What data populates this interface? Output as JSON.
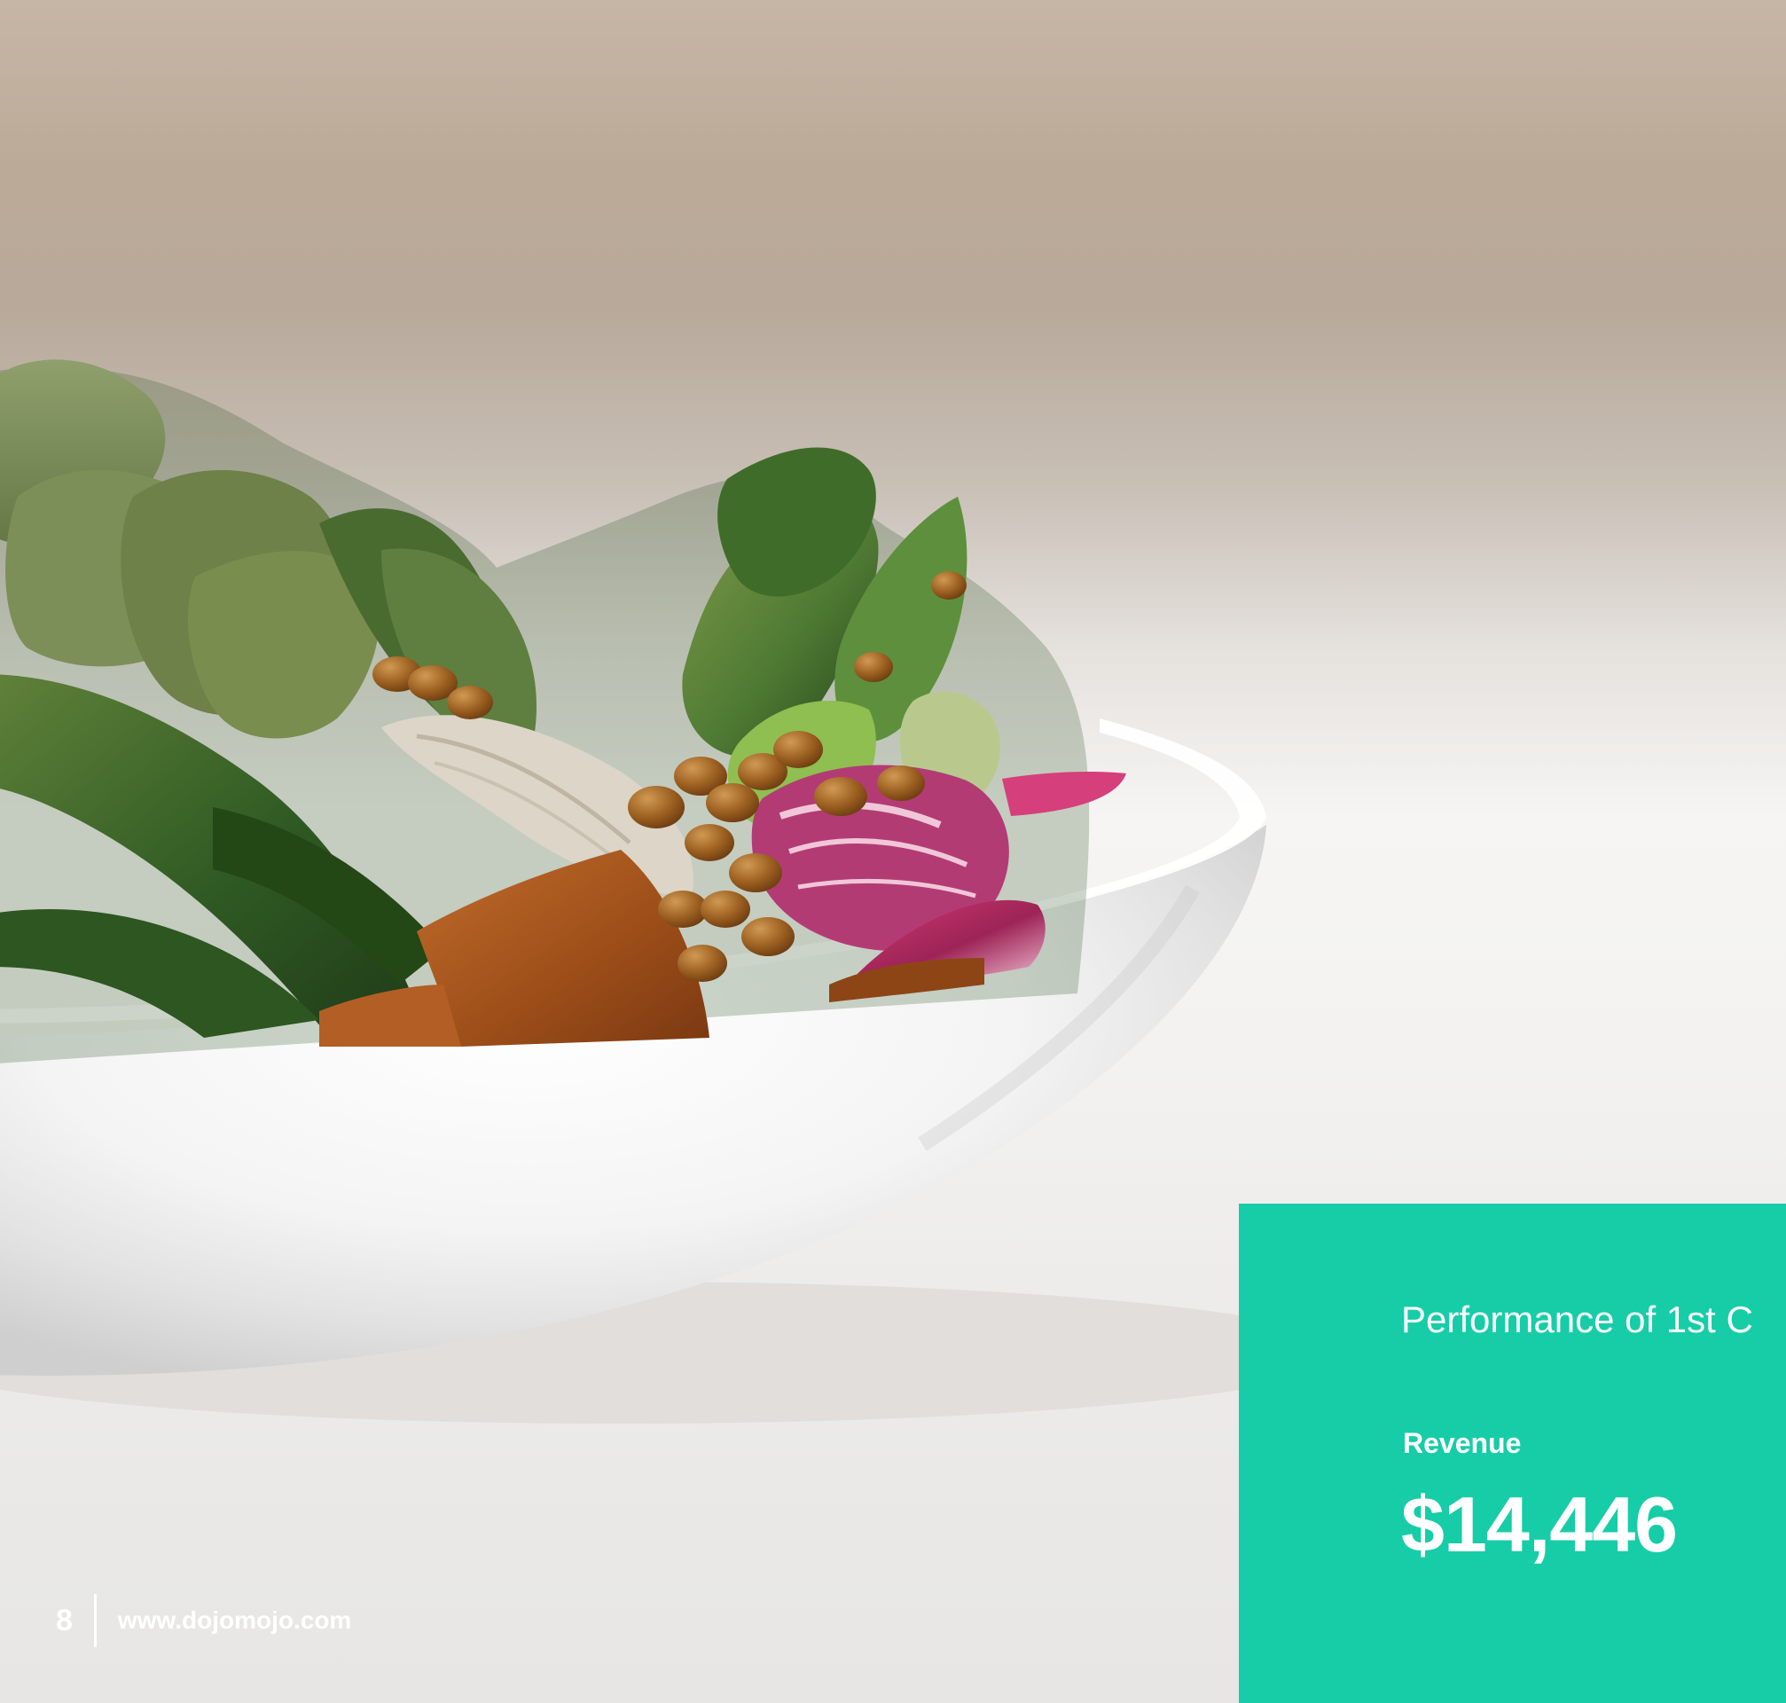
{
  "panel": {
    "title": "Performance of 1st C",
    "metric_label": "Revenue",
    "metric_value": "$14,446",
    "accent_color": "#16cda8"
  },
  "footer": {
    "page_number": "8",
    "website": "www.dojomojo.com"
  },
  "image": {
    "content": "salad-bowl-photo"
  }
}
